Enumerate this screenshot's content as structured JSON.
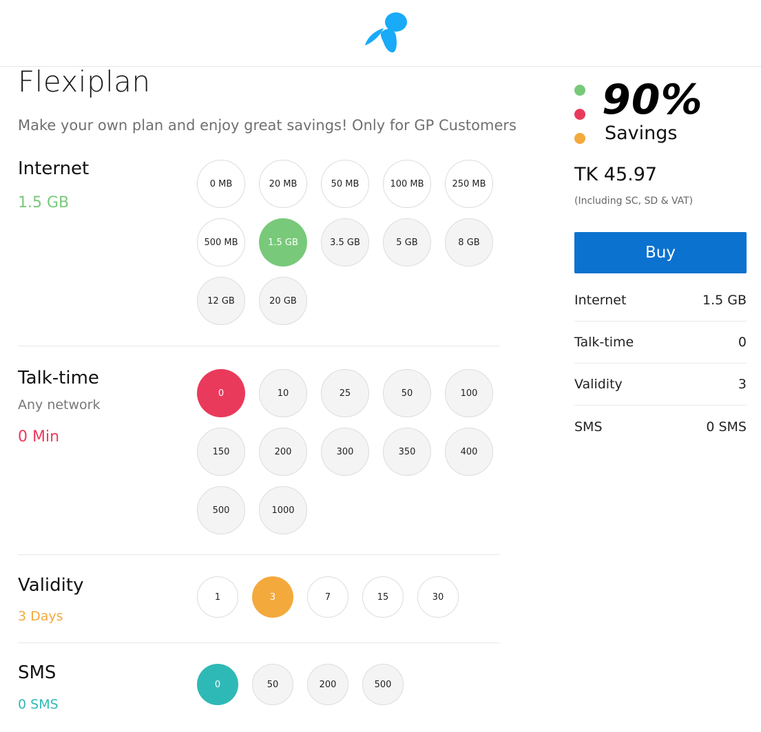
{
  "header": {
    "logo": "telenor-logo-icon"
  },
  "colors": {
    "internet": "#78c97a",
    "talktime": "#ea3a5b",
    "validity": "#f3a93c",
    "sms": "#2fb9b6",
    "buy": "#0c72cf",
    "logo": "#19aaf8"
  },
  "page": {
    "title": "Flexiplan",
    "subtitle": "Make your own plan and enjoy great savings! Only for GP Customers"
  },
  "internet": {
    "label": "Internet",
    "value": "1.5 GB",
    "options": [
      "0 MB",
      "20 MB",
      "50 MB",
      "100 MB",
      "250 MB",
      "500 MB",
      "1.5 GB",
      "3.5 GB",
      "5 GB",
      "8 GB",
      "12 GB",
      "20 GB"
    ],
    "selected": "1.5 GB"
  },
  "talktime": {
    "label": "Talk-time",
    "note": "Any network",
    "value": "0 Min",
    "options": [
      "0",
      "10",
      "25",
      "50",
      "100",
      "150",
      "200",
      "300",
      "350",
      "400",
      "500",
      "1000"
    ],
    "selected": "0"
  },
  "validity": {
    "label": "Validity",
    "value": "3 Days",
    "options": [
      "1",
      "3",
      "7",
      "15",
      "30"
    ],
    "selected": "3"
  },
  "sms": {
    "label": "SMS",
    "value": "0 SMS",
    "options": [
      "0",
      "50",
      "200",
      "500"
    ],
    "selected": "0"
  },
  "summary": {
    "savings_percent": "90%",
    "savings_label": "Savings",
    "price": "TK 45.97",
    "price_note": "(Including SC, SD & VAT)",
    "buy_label": "Buy",
    "rows": [
      {
        "label": "Internet",
        "value": "1.5 GB"
      },
      {
        "label": "Talk-time",
        "value": "0"
      },
      {
        "label": "Validity",
        "value": "3"
      },
      {
        "label": "SMS",
        "value": "0 SMS"
      }
    ]
  }
}
